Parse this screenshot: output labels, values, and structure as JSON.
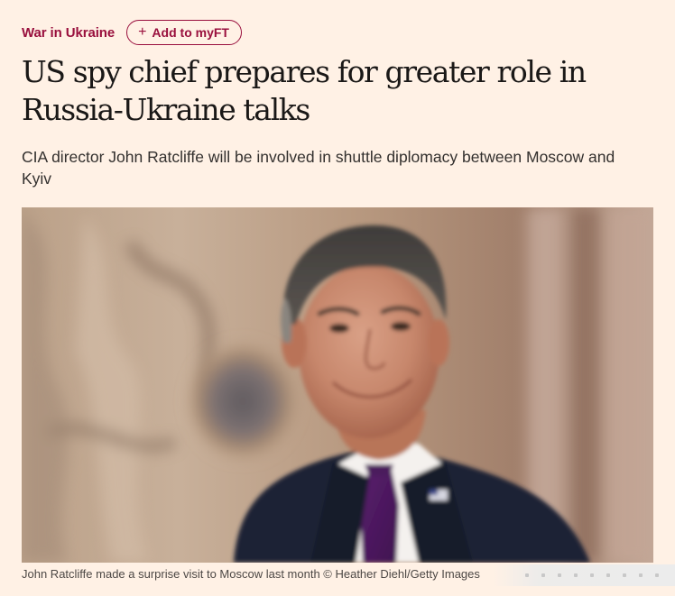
{
  "topic": {
    "label": "War in Ukraine"
  },
  "myft": {
    "icon": "plus-icon",
    "label": "Add to myFT"
  },
  "article": {
    "headline": "US spy chief prepares for greater role in Russia-Ukraine talks",
    "standfirst": "CIA director John Ratcliffe will be involved in shuttle diplomacy between Moscow and Kyiv",
    "image": {
      "caption": "John Ratcliffe made a surprise visit to Moscow last month © Heather Diehl/Getty Images"
    }
  },
  "colors": {
    "page_background": "#fff1e5",
    "brand_claret": "#990f3d",
    "text": "#33302e"
  }
}
